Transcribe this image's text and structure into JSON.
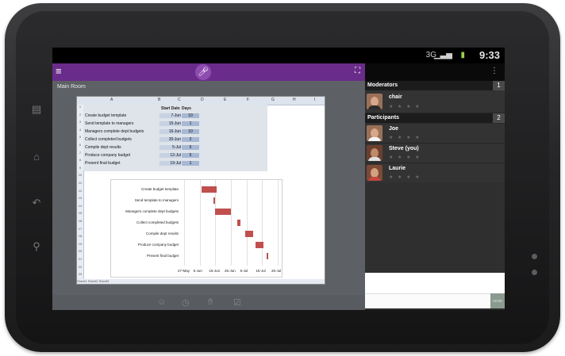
{
  "status": {
    "time": "9:33",
    "network_type": "3G",
    "icons": [
      "signal-icon",
      "battery-icon"
    ]
  },
  "appbar": {
    "menu_icon": "menu-icon",
    "mic_icon": "microphone-icon",
    "expand_icon": "expand-icon"
  },
  "room": {
    "title": "Main Room"
  },
  "spreadsheet": {
    "headers": {
      "start_date": "Start Date",
      "days": "Days"
    },
    "columns": [
      "A",
      "B",
      "C",
      "D",
      "E",
      "F",
      "G",
      "H",
      "I"
    ],
    "rows": [
      {
        "task": "Create budget template",
        "date": "7-Jun",
        "days": "10"
      },
      {
        "task": "Send template to managers",
        "date": "15-Jun",
        "days": "1"
      },
      {
        "task": "Managers complete dept budgets",
        "date": "16-Jun",
        "days": "10"
      },
      {
        "task": "Collect completed budgets",
        "date": "30-Jun",
        "days": "2"
      },
      {
        "task": "Compile dept results",
        "date": "5-Jul",
        "days": "5"
      },
      {
        "task": "Produce company budget",
        "date": "12-Jul",
        "days": "5"
      },
      {
        "task": "Present final budget",
        "date": "19-Jul",
        "days": "1"
      }
    ],
    "sheet_tabs": "Sheet1 Sheet2 Sheet3"
  },
  "chart_data": {
    "type": "bar",
    "orientation": "horizontal-gantt",
    "categories": [
      "Create budget template",
      "Send template to managers",
      "Managers complete dept budgets",
      "Collect completed budgets",
      "Compile dept results",
      "Produce company budget",
      "Present final budget"
    ],
    "x_ticks": [
      "27-May",
      "6-Jun",
      "16-Jun",
      "26-Jun",
      "6-Jul",
      "16-Jul",
      "26-Jul"
    ],
    "start_days_from_axis": [
      11,
      19,
      20,
      34,
      39,
      46,
      53
    ],
    "durations": [
      10,
      1,
      10,
      2,
      5,
      5,
      1
    ],
    "xlim_days": [
      0,
      60
    ],
    "bar_color": "#c0504d"
  },
  "toolbar": {
    "icons": [
      "emoji-icon",
      "clock-icon",
      "hand-raise-icon",
      "checkbox-icon"
    ]
  },
  "sidebar": {
    "overflow_icon": "overflow-menu-icon",
    "moderators": {
      "label": "Moderators",
      "count": "1",
      "people": [
        {
          "name": "chair"
        }
      ]
    },
    "participants": {
      "label": "Participants",
      "count": "2",
      "people": [
        {
          "name": "Joe"
        },
        {
          "name": "Steve (you)"
        },
        {
          "name": "Laurie"
        }
      ]
    },
    "status_glyphs": "★ ★ ★ ★",
    "chat": {
      "input_placeholder": "",
      "send_label": "SEND"
    }
  }
}
